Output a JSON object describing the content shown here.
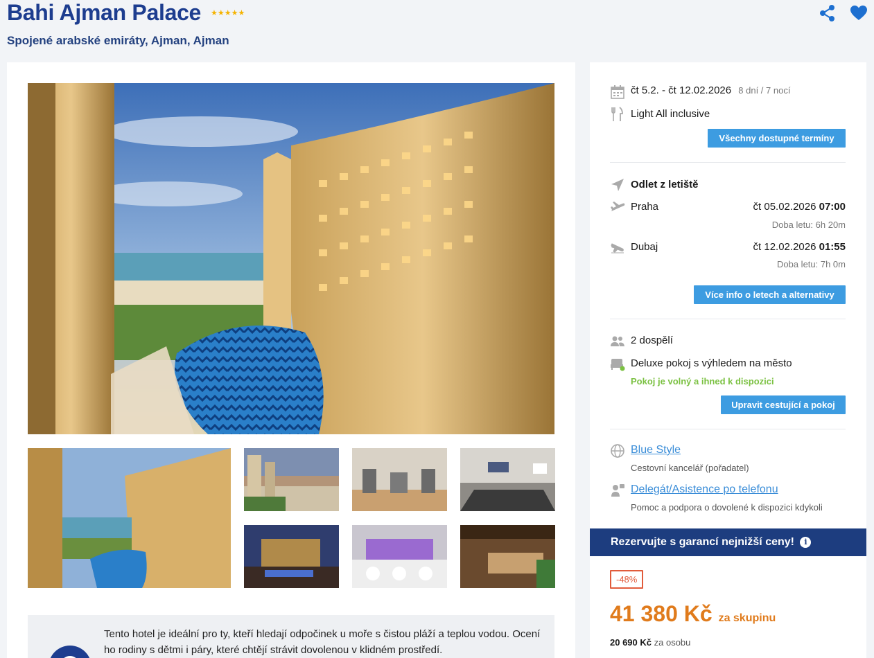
{
  "hotel": {
    "name": "Bahi Ajman Palace",
    "stars": "★★★★★",
    "location": "Spojené arabské emiráty, Ajman, Ajman"
  },
  "description": {
    "text": "Tento hotel je ideální pro ty, kteří hledají odpočinek u moře s čistou pláží a teplou vodou. Ocení ho rodiny s dětmi i páry, které chtějí strávit dovolenou v klidném prostředí."
  },
  "trip": {
    "dates": "čt 5.2. - čt 12.02.2026",
    "duration": "8 dní / 7 nocí",
    "board": "Light All inclusive",
    "all_dates_button": "Všechny dostupné termíny"
  },
  "flights": {
    "heading": "Odlet z letiště",
    "outbound": {
      "city": "Praha",
      "date": "čt 05.02.2026",
      "time": "07:00",
      "duration": "Doba letu: 6h 20m"
    },
    "inbound": {
      "city": "Dubaj",
      "date": "čt 12.02.2026",
      "time": "01:55",
      "duration": "Doba letu: 7h 0m"
    },
    "more_button": "Více info o letech a alternativy"
  },
  "travelers": {
    "count": "2 dospělí",
    "room": "Deluxe pokoj s výhledem na město",
    "availability": "Pokoj je volný a ihned k dispozici",
    "edit_button": "Upravit cestující a pokoj"
  },
  "agency": {
    "name": "Blue Style",
    "role": "Cestovní kancelář (pořadatel)",
    "assist": "Delegát/Asistence po telefonu",
    "assist_desc": "Pomoc a podpora o dovolené k dispozici kdykoli"
  },
  "booking": {
    "banner": "Rezervujte s garancí nejnižší ceny!",
    "info": "i",
    "discount": "-48%",
    "price": "41 380 Kč",
    "price_suffix": "za skupinu",
    "per_person_value": "20 690 Kč",
    "per_person_suffix": "za osobu"
  },
  "colors": {
    "brand_blue": "#1d3d8f",
    "button_blue": "#3d9ce1",
    "price_orange": "#e07b1c",
    "available_green": "#7bc142"
  }
}
